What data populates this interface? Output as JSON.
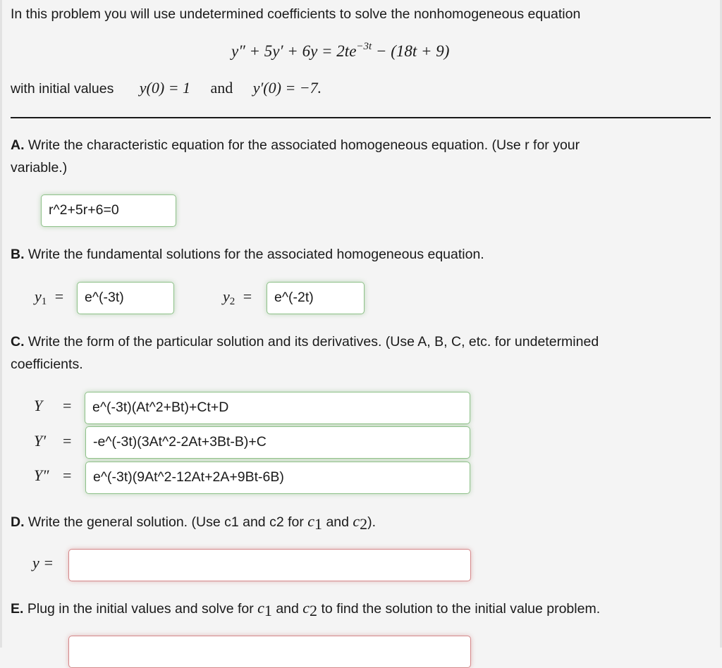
{
  "intro": {
    "text": "In this problem you will use undetermined coefficients to solve the nonhomogeneous equation",
    "equation": {
      "lhs": "y″ + 5y′ + 6y = 2te",
      "exponent": "−3t",
      "rhs_tail": " − (18t + 9)"
    },
    "initial_values_label": "with initial values",
    "iv1": "y(0) = 1",
    "and": "and",
    "iv2": "y′(0) = −7."
  },
  "parts": {
    "A": {
      "letter": "A.",
      "prompt": " Write the characteristic equation for the associated homogeneous equation. (Use r for your",
      "prompt_line2": "variable.)",
      "answer": "r^2+5r+6=0",
      "status": "correct"
    },
    "B": {
      "letter": "B.",
      "prompt": " Write the fundamental solutions for the associated homogeneous equation.",
      "y1_label": "y",
      "y1_sub": "1",
      "y1_answer": "e^(-3t)",
      "y2_label": "y",
      "y2_sub": "2",
      "y2_answer": "e^(-2t)",
      "equals": "=",
      "status": "correct"
    },
    "C": {
      "letter": "C.",
      "prompt": " Write the form of the particular solution and its derivatives. (Use A, B, C, etc. for undetermined",
      "prompt_line2": "coefficients.",
      "rows": [
        {
          "label": "Y",
          "equals": "=",
          "answer": "e^(-3t)(At^2+Bt)+Ct+D"
        },
        {
          "label": "Y′",
          "equals": "=",
          "answer": "-e^(-3t)(3At^2-2At+3Bt-B)+C"
        },
        {
          "label": "Y″",
          "equals": "=",
          "answer": "e^(-3t)(9At^2-12At+2A+9Bt-6B)"
        }
      ],
      "status": "correct"
    },
    "D": {
      "letter": "D.",
      "prompt_a": " Write the general solution. (Use c1 and c2 for ",
      "c": "c",
      "sub1": "1",
      "and": " and ",
      "sub2": "2",
      "prompt_end": ").",
      "y_label": "y =",
      "answer": "",
      "status": "incorrect"
    },
    "E": {
      "letter": "E.",
      "prompt_a": " Plug in the initial values and solve for ",
      "c": "c",
      "sub1": "1",
      "and": " and ",
      "sub2": "2",
      "prompt_end": " to find the solution to the initial value problem.",
      "answer": "",
      "status": "incorrect"
    }
  }
}
